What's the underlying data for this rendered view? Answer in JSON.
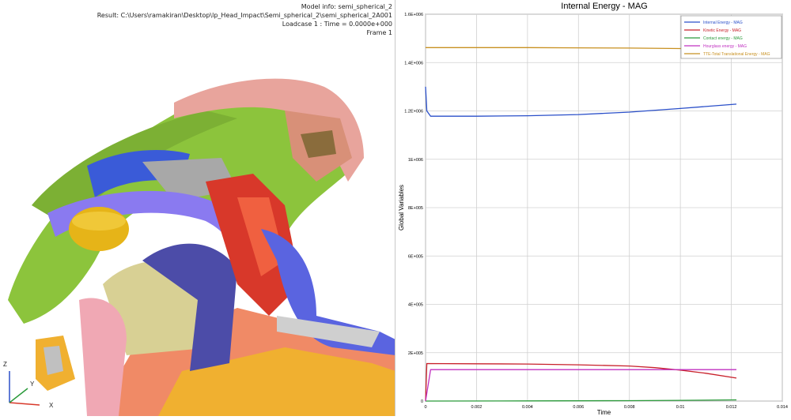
{
  "viewport": {
    "model_info": "Model info: semi_spherical_2",
    "result": "Result:  C:\\Users\\ramakiran\\Desktop\\lp_Head_Impact\\Semi_spherical_2\\semi_spherical_2A001",
    "loadcase": "Loadcase 1 : Time = 0.0000e+000",
    "frame": "Frame 1",
    "triad": {
      "z": "Z",
      "y": "Y",
      "x": "X"
    }
  },
  "chart_data": {
    "type": "line",
    "title": "Internal Energy - MAG",
    "xlabel": "Time",
    "ylabel": "Global Variables",
    "xlim": [
      0,
      0.014
    ],
    "ylim": [
      0,
      1600000
    ],
    "xticks": [
      0,
      0.002,
      0.004,
      0.006,
      0.008,
      0.01,
      0.012,
      0.014
    ],
    "xtick_labels": [
      "0",
      "0.002",
      "0.004",
      "0.006",
      "0.008",
      "0.01",
      "0.012",
      "0.014"
    ],
    "yticks": [
      0,
      200000,
      400000,
      600000,
      800000,
      1000000,
      1200000,
      1400000,
      1600000
    ],
    "ytick_labels": [
      "0",
      "2E+005",
      "4E+005",
      "6E+005",
      "8E+005",
      "1E+006",
      "1.2E+006",
      "1.4E+006",
      "1.6E+006"
    ],
    "grid": true,
    "legend_position": "top-right",
    "series": [
      {
        "name": "Internal Energy - MAG",
        "color": "#2a4fc9",
        "x": [
          0,
          5e-05,
          0.0002,
          0.001,
          0.002,
          0.004,
          0.006,
          0.008,
          0.01,
          0.0122
        ],
        "y": [
          1300000,
          1200000,
          1178000,
          1178000,
          1178000,
          1180000,
          1185000,
          1195000,
          1210000,
          1228000
        ]
      },
      {
        "name": "Kinetic Energy - MAG",
        "color": "#c8202a",
        "x": [
          0,
          5e-05,
          0.002,
          0.004,
          0.006,
          0.008,
          0.009,
          0.01,
          0.011,
          0.0122
        ],
        "y": [
          0,
          155000,
          154000,
          153000,
          150000,
          145000,
          138000,
          128000,
          115000,
          95000
        ]
      },
      {
        "name": "Contact energy - MAG",
        "color": "#2a9a3a",
        "x": [
          0,
          0.004,
          0.008,
          0.01,
          0.0122
        ],
        "y": [
          0,
          500,
          1500,
          3000,
          5000
        ]
      },
      {
        "name": "Hourglass energy - MAG",
        "color": "#c030c0",
        "x": [
          0,
          0.0002,
          0.002,
          0.006,
          0.01,
          0.0122
        ],
        "y": [
          0,
          130000,
          130000,
          130000,
          130000,
          130000
        ]
      },
      {
        "name": "TTE-Total Translational Energy - MAG",
        "color": "#c89020",
        "x": [
          0,
          0.0001,
          0.002,
          0.004,
          0.006,
          0.008,
          0.01,
          0.0122
        ],
        "y": [
          1462000,
          1462000,
          1462000,
          1462000,
          1461000,
          1460000,
          1458000,
          1455000
        ]
      }
    ]
  }
}
